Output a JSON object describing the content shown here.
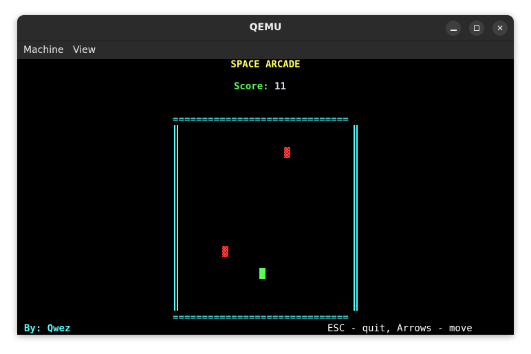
{
  "window": {
    "title": "QEMU"
  },
  "menubar": {
    "items": [
      "Machine",
      "View"
    ]
  },
  "game": {
    "title": "SPACE ARCADE",
    "score_label": "Score:",
    "score_value": "11",
    "wall_top": "==============================",
    "wall_bottom": "==============================",
    "credit": "By: Qwez",
    "help": "ESC - quit, Arrows - move"
  },
  "colors": {
    "title": "#ffff55",
    "score_label": "#55ff55",
    "walls": "#55ffff",
    "enemy": "#ff5555",
    "player": "#55ff55",
    "background": "#000000",
    "titlebar": "#2b2b2b"
  }
}
